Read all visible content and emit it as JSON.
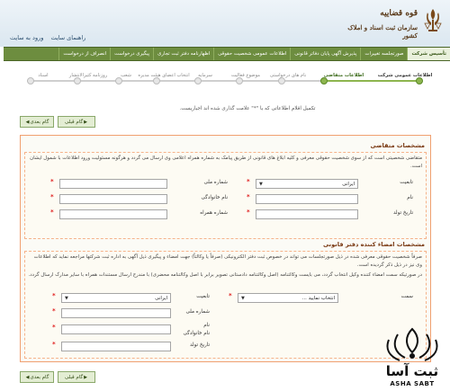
{
  "header": {
    "links": [
      "ورود به سایت",
      "راهنمای سایت"
    ],
    "logo_line1": "قوه قضاییه",
    "logo_line2": "سازمان ثبت اسناد و املاک کشور"
  },
  "menu": [
    "تأسیس شرکت",
    "صورتجلسه تغییرات",
    "پذیرش آگهی پایان دفاتر قانونی",
    "اطلاعات عمومی شخصیت حقوقی",
    "اظهارنامه دفتر ثبت تجاری",
    "پیگیری درخواست",
    "انصراف از درخواست"
  ],
  "steps": [
    {
      "label": "اطلاعات عمومی شرکت",
      "state": "done"
    },
    {
      "label": "اطلاعات متقاضی",
      "state": "active"
    },
    {
      "label": "نام های درخواستی",
      "state": "todo"
    },
    {
      "label": "موضوع فعالیت",
      "state": "todo"
    },
    {
      "label": "سرمایه",
      "state": "todo"
    },
    {
      "label": "انتخاب اعضای هیئت مدیره",
      "state": "todo"
    },
    {
      "label": "شعب",
      "state": "todo"
    },
    {
      "label": "روزنامه کثیرالانتشار",
      "state": "todo"
    },
    {
      "label": "اسناد",
      "state": "todo"
    }
  ],
  "note": "تکمیل اقلام اطلاعاتی که با \"*\" علامت گذاری شده اند اجباریست.",
  "buttons": {
    "next": "گام بعدی",
    "prev": "گام قبلی"
  },
  "applicant": {
    "title": "مشخصات متقاضی",
    "description": "متقاضی شخصیتی است که از سوی شخصیت حقوقی معرفی و کلیه ابلاغ های قانونی از طریق پیامک به شماره همراه اعلامی وی ارسال می گردد و هرگونه مسئولیت ورود اطلاعات با شمول ایشان است.",
    "nationality_label": "تابعیت",
    "nationality_value": "ایرانی",
    "national_id_label": "شماره ملی",
    "first_name_label": "نام",
    "last_name_label": "نام خانوادگی",
    "birth_date_label": "تاریخ تولد",
    "mobile_label": "شماره همراه"
  },
  "signer": {
    "title": "مشخصات امضاء کننده دفتر قانونی",
    "description_1": "صرفاً شخصیت حقوقی معرفی شده در ذیل صورتجلسات می تواند در خصوص ثبت دفتر الکترونیکی (صرفاً یا وکالتاً) جهت امضاء و پیگیری ذیل آگهی به اداره ثبت شرکتها مراجعه نماید که اطلاعات وی نیز در ذیل ذکر گردیده است.",
    "description_2": "در صورتیکه سمت امضاء کننده وکیل انتخاب گردد، می بایست وکالتنامه (اصل وکالتنامه دادستانی تصویر برابر با اصل وکالتنامه محضری) با مندرج ارسال مستندات همراه با سایر مدارک ارسال گردد.",
    "role_label": "سمت",
    "role_value": "انتخاب نمایید ...",
    "nationality_label": "تابعیت",
    "nationality_value": "ایرانی",
    "national_id_label": "شماره ملی",
    "first_name_label": "نام",
    "last_name_label": "نام خانوادگی",
    "birth_date_label": "تاریخ تولد"
  },
  "watermark": {
    "brand": "ثبت آسا",
    "brand_en": "ASHA SABT"
  },
  "colors": {
    "menu": "#6d8d3f",
    "accent": "#8db54f",
    "section_title": "#7a3a14",
    "required": "#e02020"
  }
}
